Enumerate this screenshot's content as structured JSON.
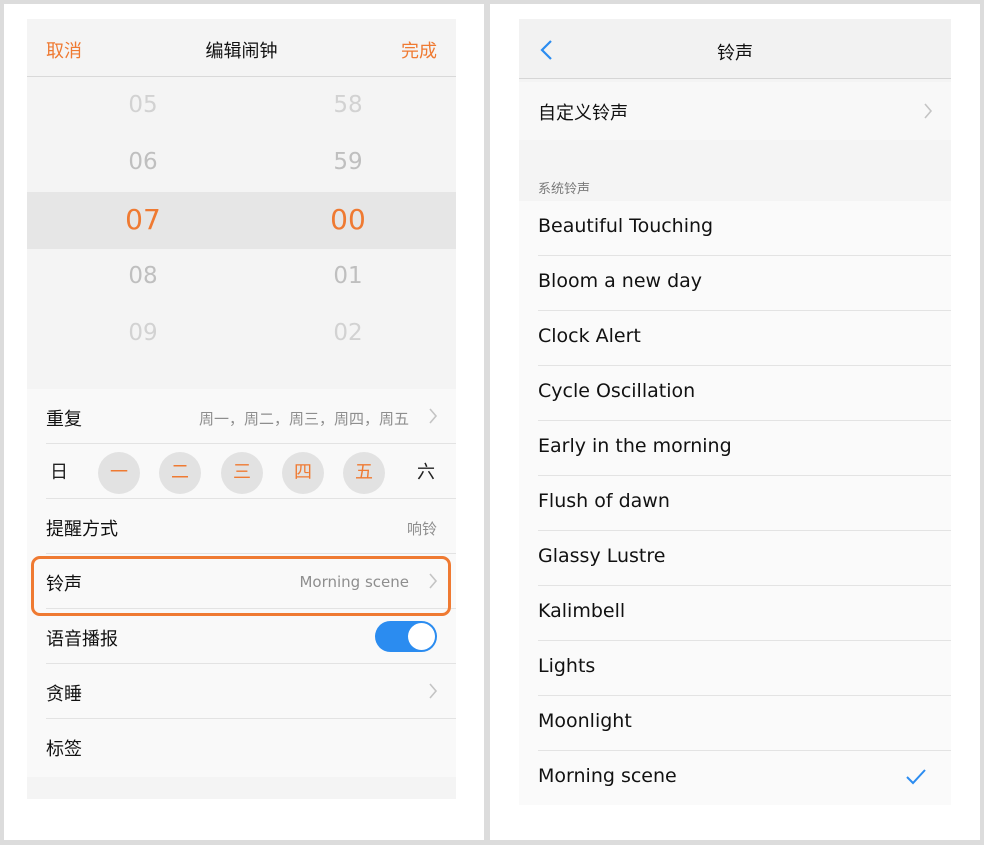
{
  "left": {
    "header": {
      "cancel": "取消",
      "title": "编辑闹钟",
      "done": "完成"
    },
    "picker": {
      "hours": [
        "05",
        "06",
        "07",
        "08",
        "09"
      ],
      "minutes": [
        "58",
        "59",
        "00",
        "01",
        "02"
      ]
    },
    "repeat": {
      "label": "重复",
      "value": "周一，周二，周三，周四，周五"
    },
    "days": [
      {
        "label": "日",
        "selected": false
      },
      {
        "label": "一",
        "selected": true
      },
      {
        "label": "二",
        "selected": true
      },
      {
        "label": "三",
        "selected": true
      },
      {
        "label": "四",
        "selected": true
      },
      {
        "label": "五",
        "selected": true
      },
      {
        "label": "六",
        "selected": false
      }
    ],
    "reminder": {
      "label": "提醒方式",
      "value": "响铃"
    },
    "ringtone": {
      "label": "铃声",
      "value": "Morning scene"
    },
    "voice": {
      "label": "语音播报",
      "on": true
    },
    "snooze": {
      "label": "贪睡"
    },
    "tag": {
      "label": "标签"
    }
  },
  "right": {
    "header": {
      "title": "铃声"
    },
    "custom": {
      "label": "自定义铃声"
    },
    "section_title": "系统铃声",
    "ringtones": [
      "Beautiful Touching",
      "Bloom a new day",
      "Clock Alert",
      "Cycle Oscillation",
      "Early in the morning",
      "Flush of dawn",
      "Glassy Lustre",
      "Kalimbell",
      "Lights",
      "Moonlight",
      "Morning scene"
    ],
    "selected_ringtone": "Morning scene"
  },
  "colors": {
    "accent": "#ef7a32",
    "toggle": "#2b8cf0",
    "check": "#2b8cf0"
  }
}
